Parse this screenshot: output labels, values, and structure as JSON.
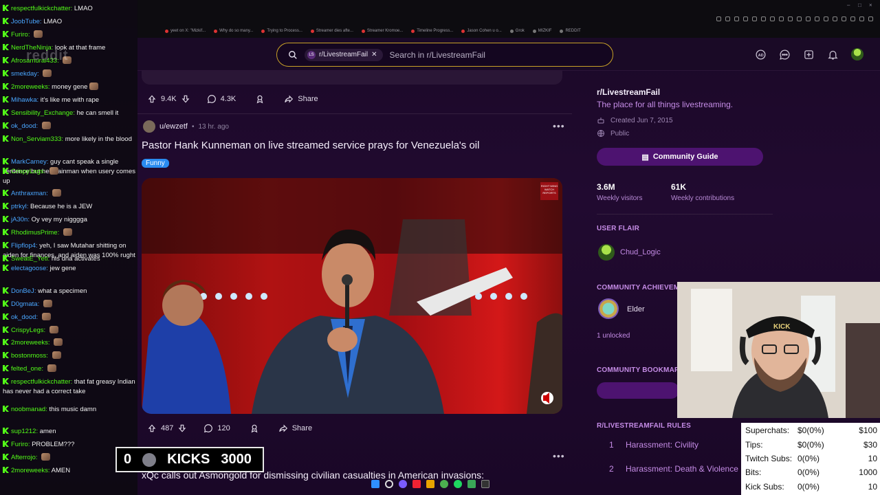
{
  "chat": {
    "watermark": "reddit",
    "messages": [
      {
        "user": "respectfulkickchatter",
        "text": "LMAO",
        "color": "#53fc18"
      },
      {
        "user": "JoobTube",
        "text": "LMAO",
        "color": "#4aa7ff"
      },
      {
        "user": "Furiro",
        "text": "",
        "color": "#53fc18",
        "emote": true
      },
      {
        "user": "NerdTheNinja",
        "text": "look at that frame",
        "color": "#53fc18"
      },
      {
        "user": "Afrosamurai433",
        "text": "",
        "color": "#53fc18",
        "emote": true
      },
      {
        "user": "smekday",
        "text": "",
        "color": "#4aa7ff",
        "emote": true
      },
      {
        "user": "2moreweeks",
        "text": "money gene",
        "color": "#53fc18",
        "emote": true
      },
      {
        "user": "Mihawka",
        "text": "it's like me with rape",
        "color": "#4aa7ff"
      },
      {
        "user": "Sensibility_Exchange",
        "text": "he can smell it",
        "color": "#53fc18"
      },
      {
        "user": "ok_dood",
        "text": "",
        "color": "#4aa7ff",
        "emote": true
      },
      {
        "user": "Non_Serviam333",
        "text": "more likely in the blood",
        "color": "#53fc18"
      },
      {
        "user": "smekday2",
        "text": "",
        "color": "#4aa7ff"
      },
      {
        "user": "MarkCarney",
        "text": "guy cant speak a single sentence but he's rainman when usery comes up",
        "color": "#4aa7ff"
      },
      {
        "user": "CrispyLegs",
        "text": "",
        "color": "#53fc18",
        "emote": true
      },
      {
        "user": "Anthraxman",
        "text": "",
        "color": "#4aa7ff",
        "emote": true
      },
      {
        "user": "ptrkyl",
        "text": "Because he is a JEW",
        "color": "#4aa7ff"
      },
      {
        "user": "jA30n",
        "text": "Oy vey my nigggga",
        "color": "#4aa7ff"
      },
      {
        "user": "RhodimusPrime",
        "text": "",
        "color": "#53fc18",
        "emote": true
      },
      {
        "user": "Flipflop4",
        "text": "yeh, I saw Mutahar shitting on aiden for finances, and aiden was 100% rught",
        "color": "#4aa7ff"
      },
      {
        "user": "SweatE_Yeti",
        "text": "his dna activates",
        "color": "#53fc18"
      },
      {
        "user": "electagoose",
        "text": "jew gene",
        "color": "#4aa7ff"
      },
      {
        "user": "DonBeJ",
        "text": "what a specimen",
        "color": "#4aa7ff"
      },
      {
        "user": "D0gmata",
        "text": "",
        "color": "#4aa7ff",
        "emote": true
      },
      {
        "user": "ok_dood",
        "text": "",
        "color": "#4aa7ff",
        "emote": true
      },
      {
        "user": "CrispyLegs",
        "text": "",
        "color": "#53fc18",
        "emote": true
      },
      {
        "user": "2moreweeks",
        "text": "",
        "color": "#53fc18",
        "emote": true
      },
      {
        "user": "bostonmoss",
        "text": "",
        "color": "#53fc18",
        "emote": true
      },
      {
        "user": "felted_one",
        "text": "",
        "color": "#53fc18",
        "emote": true
      },
      {
        "user": "respectfulkickchatter",
        "text": "that fat greasy Indian has never had a correct take",
        "color": "#53fc18"
      },
      {
        "user": "noobmanad",
        "text": "this music damn",
        "color": "#53fc18"
      },
      {
        "user": "sup1212",
        "text": "amen",
        "color": "#53fc18"
      },
      {
        "user": "Furiro",
        "text": "PROBLEM???",
        "color": "#53fc18"
      },
      {
        "user": "Afterrojo",
        "text": "",
        "color": "#53fc18",
        "emote": true
      },
      {
        "user": "2moreweeks",
        "text": "AMEN",
        "color": "#53fc18"
      }
    ]
  },
  "browser": {
    "bookmarks": [
      "yeet on X: \"Mizkif...",
      "Why do so many...",
      "Trying to Process...",
      "Streamer dies afte...",
      "Streamer Kromoe...",
      "Timeline Progress...",
      "Jason Cohen u o...",
      "Grok",
      "MIZKIF",
      "REDDIT"
    ]
  },
  "header": {
    "search_chip": "r/LivestreamFail",
    "search_placeholder": "Search in r/LivestreamFail",
    "icons": [
      "ad-icon",
      "chat-icon",
      "create-icon",
      "notification-icon",
      "profile-avatar"
    ]
  },
  "feed": {
    "prev_post": {
      "upvotes": "9.4K",
      "comments": "4.3K",
      "share": "Share"
    },
    "post": {
      "author": "u/ewzetf",
      "time": "13 hr. ago",
      "title": "Pastor Hank Kunneman on live streamed service prays for Venezuela's oil",
      "flair": "Funny",
      "upvotes": "487",
      "comments": "120",
      "share": "Share",
      "watermark": "RIGHT WING WATCH REPORTS"
    },
    "next_post": {
      "title": "xQc calls out Asmongold for dismissing civilian casualties in American invasions:"
    }
  },
  "sidebar": {
    "name": "r/LivestreamFail",
    "description": "The place for all things livestreaming.",
    "created": "Created Jun 7, 2015",
    "visibility": "Public",
    "guide_button": "Community Guide",
    "visitors_value": "3.6M",
    "visitors_label": "Weekly visitors",
    "contrib_value": "61K",
    "contrib_label": "Weekly contributions",
    "user_flair_heading": "USER FLAIR",
    "user_flair_name": "Chud_Logic",
    "achievements_heading": "COMMUNITY ACHIEVEM",
    "achievement_name": "Elder",
    "achievement_unlocked": "1 unlocked",
    "bookmarks_heading": "COMMUNITY BOOKMAR",
    "rules_heading": "R/LIVESTREAMFAIL RULES",
    "rules": [
      {
        "n": "1",
        "text": "Harassment: Civility"
      },
      {
        "n": "2",
        "text": "Harassment: Death & Violence"
      }
    ]
  },
  "overlay": {
    "kicks_left": "0",
    "kicks_label": "KICKS",
    "kicks_goal": "3000",
    "donations": [
      {
        "label": "Superchats:",
        "progress": "$0(0%)",
        "goal": "$100"
      },
      {
        "label": "Tips:",
        "progress": "$0(0%)",
        "goal": "$30"
      },
      {
        "label": "Twitch Subs:",
        "progress": "0(0%)",
        "goal": "10"
      },
      {
        "label": "Bits:",
        "progress": "0(0%)",
        "goal": "1000"
      },
      {
        "label": "Kick Subs:",
        "progress": "0(0%)",
        "goal": "10"
      }
    ]
  },
  "colors": {
    "accent": "#c58ce6",
    "kick_green": "#53fc18",
    "search_border": "#c9a227"
  }
}
